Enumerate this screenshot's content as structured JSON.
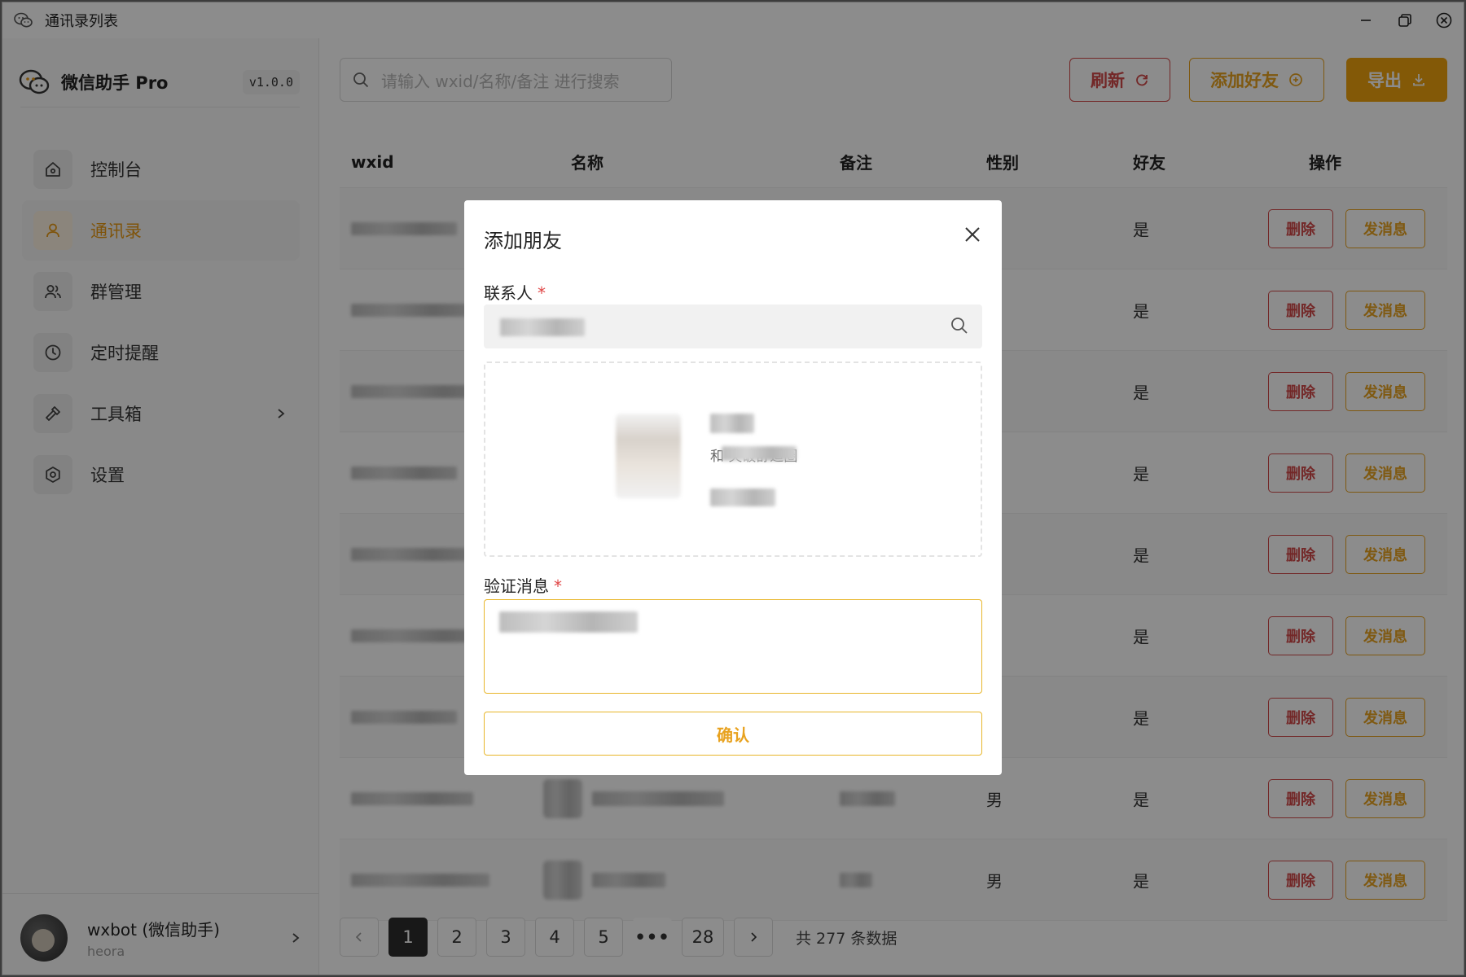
{
  "window": {
    "title": "通讯录列表"
  },
  "sidebar": {
    "brand": "微信助手 Pro",
    "version": "v1.0.0",
    "items": [
      {
        "label": "控制台",
        "icon": "home-icon"
      },
      {
        "label": "通讯录",
        "icon": "user-icon",
        "active": true
      },
      {
        "label": "群管理",
        "icon": "users-icon"
      },
      {
        "label": "定时提醒",
        "icon": "clock-icon"
      },
      {
        "label": "工具箱",
        "icon": "tool-icon"
      },
      {
        "label": "设置",
        "icon": "gear-icon"
      }
    ],
    "user": {
      "name": "wxbot (微信助手)",
      "handle": "heora"
    }
  },
  "toolbar": {
    "search_placeholder": "请输入 wxid/名称/备注 进行搜索",
    "refresh_label": "刷新",
    "add_friend_label": "添加好友",
    "export_label": "导出"
  },
  "table": {
    "columns": [
      "wxid",
      "名称",
      "备注",
      "性别",
      "好友",
      "操作"
    ],
    "rows": [
      {
        "sex": "",
        "friend": "是"
      },
      {
        "sex": "",
        "friend": "是"
      },
      {
        "sex": "",
        "friend": "是"
      },
      {
        "sex": "",
        "friend": "是"
      },
      {
        "sex": "",
        "friend": "是"
      },
      {
        "sex": "",
        "friend": "是"
      },
      {
        "sex": "",
        "friend": "是"
      },
      {
        "sex": "男",
        "friend": "是"
      },
      {
        "sex": "男",
        "friend": "是"
      }
    ],
    "delete_label": "删除",
    "message_label": "发消息"
  },
  "pagination": {
    "pages": [
      "1",
      "2",
      "3",
      "4",
      "5",
      "•••",
      "28"
    ],
    "current": "1",
    "total_text": "共 277 条数据"
  },
  "modal": {
    "title": "添加朋友",
    "contact_label": "联系人",
    "required_mark": "*",
    "signature_fragment": "和          突破舒适圈",
    "verify_label": "验证消息",
    "confirm_label": "确认"
  },
  "colors": {
    "accent": "#eea20e",
    "danger": "#d14949",
    "pager_active": "#2d2d2d"
  }
}
